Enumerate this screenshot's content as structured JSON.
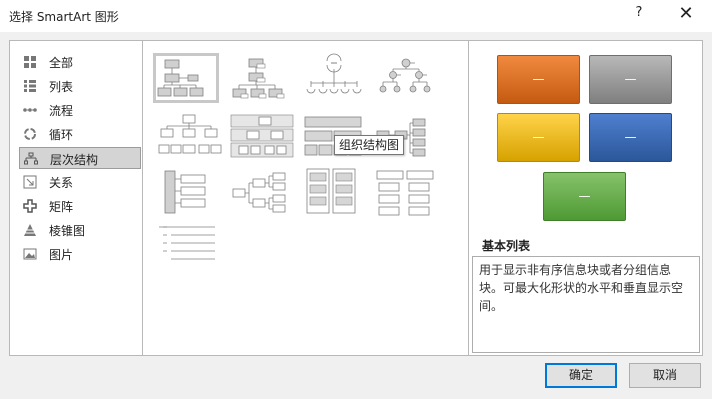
{
  "dialog": {
    "title": "选择 SmartArt 图形",
    "help_label": "?",
    "close_label": "✕"
  },
  "categories": [
    {
      "label": "全部",
      "icon": "grid-all-icon"
    },
    {
      "label": "列表",
      "icon": "list-icon"
    },
    {
      "label": "流程",
      "icon": "process-icon"
    },
    {
      "label": "循环",
      "icon": "cycle-icon"
    },
    {
      "label": "层次结构",
      "icon": "hierarchy-icon",
      "selected": true
    },
    {
      "label": "关系",
      "icon": "relationship-icon"
    },
    {
      "label": "矩阵",
      "icon": "matrix-icon"
    },
    {
      "label": "棱锥图",
      "icon": "pyramid-icon"
    },
    {
      "label": "图片",
      "icon": "picture-icon"
    }
  ],
  "gallery": {
    "tooltip": "组织结构图",
    "selected_index": 0
  },
  "preview": {
    "tile_label": "—",
    "colors": {
      "orange": "#c55a11",
      "gray": "#7f7f7f",
      "yellow": "#d6a200",
      "blue": "#2b579a",
      "green": "#4e9a34"
    },
    "layout_name": "基本列表",
    "description": "用于显示非有序信息块或者分组信息块。可最大化形状的水平和垂直显示空间。"
  },
  "buttons": {
    "ok": "确定",
    "cancel": "取消"
  }
}
